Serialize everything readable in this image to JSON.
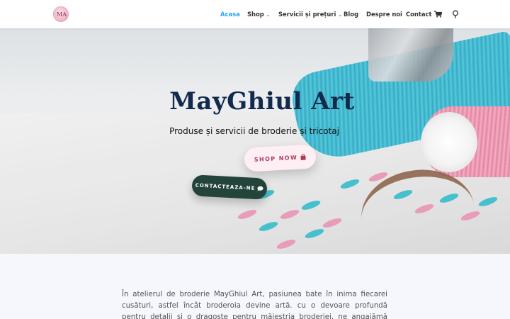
{
  "header": {
    "logo_text": "MA",
    "nav": [
      {
        "label": "Acasa",
        "active": true
      },
      {
        "label": "Shop",
        "dropdown": true
      },
      {
        "label": "Servicii și prețuri",
        "dropdown": true
      },
      {
        "label": "Blog"
      },
      {
        "label": "Despre noi"
      },
      {
        "label": "Contact"
      }
    ],
    "cart_icon": "cart-icon",
    "search_icon": "search-icon",
    "active_color": "#2ea3f2"
  },
  "hero": {
    "title": "MayGhiul Art",
    "subtitle": "Produse și servicii de broderie și tricotaj",
    "shop_button": "SHOP NOW",
    "shop_button_icon": "shopping-bag-icon",
    "contact_button": "CONTACTEAZA-NE",
    "contact_button_icon": "chat-bubble-icon",
    "title_color": "#122a4c"
  },
  "about": {
    "text": "În atelierul de broderie MayGhiul Art, pasiunea bate în inima fiecarei cusături, astfel încât broderoia devine artă. cu o devoare profundă pentru detalii și o dragoste pentru măiestria broderiei, ne angajămă oferim nu doar produse, ci"
  }
}
